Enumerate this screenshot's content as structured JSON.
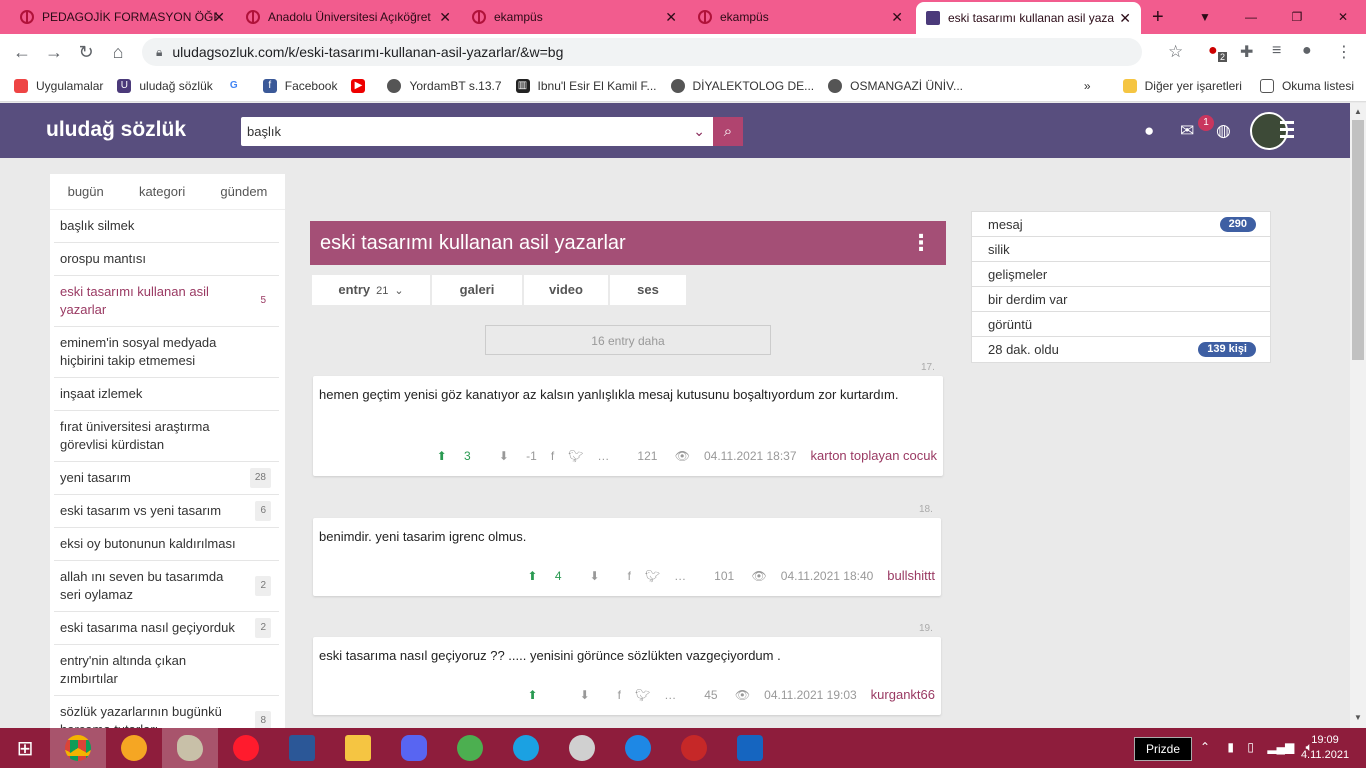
{
  "browser": {
    "tabs": [
      {
        "title": "PEDAGOJİK FORMASYON ÖĞR",
        "icon": "anadolu-icon"
      },
      {
        "title": "Anadolu Üniversitesi Açıköğret",
        "icon": "anadolu-icon"
      },
      {
        "title": "ekampüs",
        "icon": "anadolu-icon"
      },
      {
        "title": "ekampüs",
        "icon": "anadolu-icon"
      },
      {
        "title": "eski tasarımı kullanan asil yaza",
        "icon": "uludag-icon"
      }
    ],
    "url": "uludagsozluk.com/k/eski-tasarımı-kullanan-asil-yazarlar/&w=bg",
    "ext_badge": "2",
    "bookmarks": [
      {
        "label": "Uygulamalar",
        "color": "#e44"
      },
      {
        "label": "uludağ sözlük",
        "color": "#4b3a7a"
      },
      {
        "label": "",
        "color": "#4285f4"
      },
      {
        "label": "Facebook",
        "color": "#3b5998"
      },
      {
        "label": "",
        "color": "#e00"
      },
      {
        "label": "YordamBT s.13.7",
        "color": "#555"
      },
      {
        "label": "Ibnu'l Esir El Kamil F...",
        "color": "#222"
      },
      {
        "label": "DİYALEKTOLOG DE...",
        "color": "#555"
      },
      {
        "label": "OSMANGAZİ ÜNİV...",
        "color": "#555"
      }
    ],
    "other_bookmarks": "Diğer yer işaretleri",
    "reading_list": "Okuma listesi"
  },
  "site": {
    "logo": "uludağ sözlük",
    "search_value": "başlık",
    "notif_count": "1"
  },
  "left_nav": {
    "tabs": [
      "bugün",
      "kategori",
      "gündem"
    ],
    "items": [
      {
        "label": "başlık silmek",
        "count": ""
      },
      {
        "label": "orospu mantısı",
        "count": ""
      },
      {
        "label": "eski tasarımı kullanan asil yazarlar",
        "count": "5"
      },
      {
        "label": "eminem'in sosyal medyada hiçbirini takip etmemesi",
        "count": ""
      },
      {
        "label": "inşaat izlemek",
        "count": ""
      },
      {
        "label": "fırat üniversitesi araştırma görevlisi kürdistan",
        "count": ""
      },
      {
        "label": "yeni tasarım",
        "count": "28"
      },
      {
        "label": "eski tasarım vs yeni tasarım",
        "count": "6"
      },
      {
        "label": "eksi oy butonunun kaldırılması",
        "count": ""
      },
      {
        "label": "allah ını seven bu tasarımda seri oylamaz",
        "count": "2"
      },
      {
        "label": "eski tasarıma nasıl geçiyorduk",
        "count": "2"
      },
      {
        "label": "entry'nin altında çıkan zımbırtılar",
        "count": ""
      },
      {
        "label": "sözlük yazarlarının bugünkü harcama tutarları",
        "count": "8"
      }
    ]
  },
  "topic": {
    "title": "eski tasarımı kullanan asil yazarlar",
    "tabs": {
      "entry": "entry",
      "entry_count": "21",
      "galeri": "galeri",
      "video": "video",
      "ses": "ses"
    },
    "more_entries": "16 entry daha"
  },
  "entries": [
    {
      "num": "17.",
      "text": "hemen geçtim yenisi göz kanatıyor az kalsın yanlışlıkla mesaj kutusunu boşaltıyordum zor kurtardım.",
      "up": "3",
      "down": "-1",
      "views": "121",
      "date": "04.11.2021 18:37",
      "author": "karton toplayan cocuk"
    },
    {
      "num": "18.",
      "text": "benimdir. yeni tasarim igrenc olmus.",
      "up": "4",
      "down": "",
      "views": "101",
      "date": "04.11.2021 18:40",
      "author": "bullshittt"
    },
    {
      "num": "19.",
      "text": "eski tasarıma nasıl geçiyoruz ?? ..... yenisini görünce sözlükten vazgeçiyordum .",
      "up": "",
      "down": "",
      "views": "45",
      "date": "04.11.2021 19:03",
      "author": "kurgankt66"
    }
  ],
  "right_panel": [
    {
      "label": "mesaj",
      "badge": "290"
    },
    {
      "label": "silik",
      "badge": ""
    },
    {
      "label": "gelişmeler",
      "badge": ""
    },
    {
      "label": "bir derdim var",
      "badge": ""
    },
    {
      "label": "görüntü",
      "badge": ""
    },
    {
      "label": "28 dak. oldu",
      "badge": "139 kişi"
    }
  ],
  "taskbar": {
    "prizde": "Prizde",
    "time": "19:09",
    "date": "4.11.2021"
  }
}
